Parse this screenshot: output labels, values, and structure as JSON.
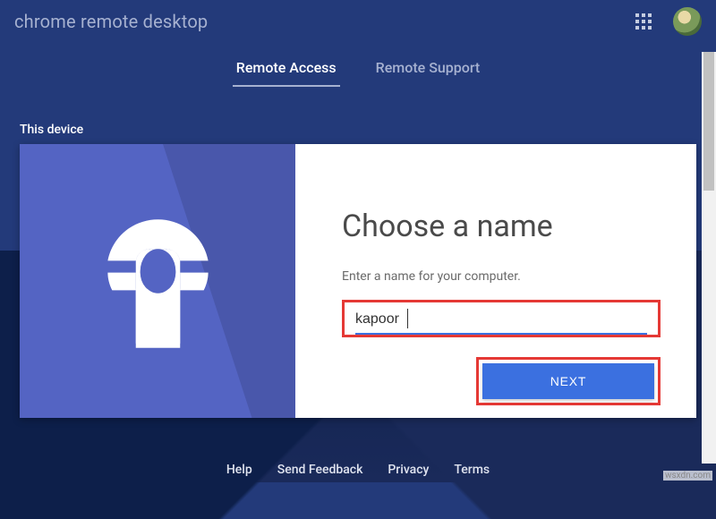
{
  "header": {
    "title": "chrome remote desktop"
  },
  "tabs": {
    "remote_access": "Remote Access",
    "remote_support": "Remote Support"
  },
  "section": {
    "this_device": "This device"
  },
  "card": {
    "title": "Choose a name",
    "subtitle": "Enter a name for your computer.",
    "input_value": "kapoor",
    "next_label": "NEXT"
  },
  "footer": {
    "help": "Help",
    "send_feedback": "Send Feedback",
    "privacy": "Privacy",
    "terms": "Terms"
  },
  "watermark": "wsxdn.com"
}
